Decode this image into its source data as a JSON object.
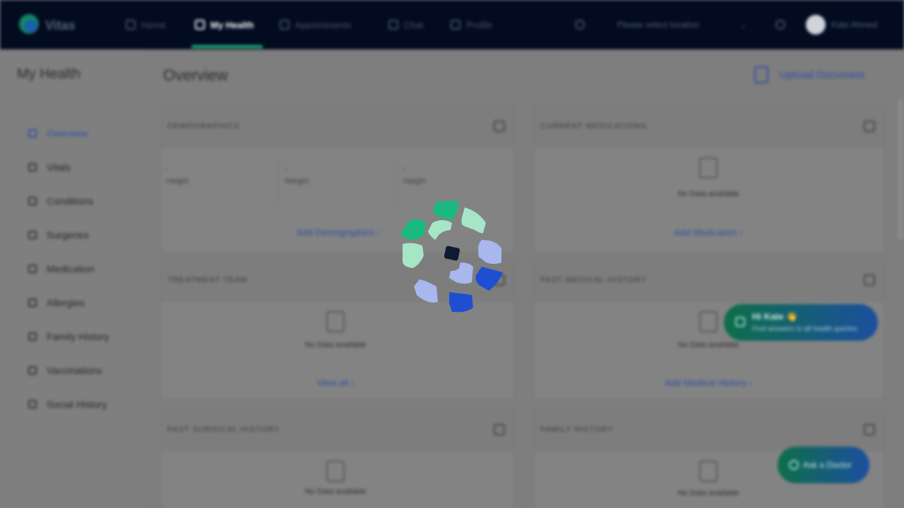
{
  "brand": {
    "name": "Vitas",
    "colors": {
      "green": "#1ab97f",
      "light_green": "#a6e6c7",
      "blue": "#1f4fd1",
      "light_blue": "#a8b8ee",
      "navy": "#020b1f"
    }
  },
  "topnav": {
    "items": [
      {
        "label": "Home",
        "icon": "home-icon"
      },
      {
        "label": "My Health",
        "icon": "heart-icon",
        "active": true
      },
      {
        "label": "Appointments",
        "icon": "calendar-icon"
      },
      {
        "label": "Chat",
        "icon": "chat-icon"
      },
      {
        "label": "Profile",
        "icon": "user-icon"
      }
    ],
    "profile_switch": "Please select location",
    "user_name": "Kate Ahmed"
  },
  "sidebar": {
    "title": "My Health",
    "items": [
      {
        "label": "Overview",
        "icon": "grid-icon",
        "active": true
      },
      {
        "label": "Vitals",
        "icon": "pulse-icon"
      },
      {
        "label": "Conditions",
        "icon": "clipboard-icon"
      },
      {
        "label": "Surgeries",
        "icon": "scalpel-icon"
      },
      {
        "label": "Medication",
        "icon": "pill-icon"
      },
      {
        "label": "Allergies",
        "icon": "alert-icon"
      },
      {
        "label": "Family History",
        "icon": "family-icon"
      },
      {
        "label": "Vaccinations",
        "icon": "syringe-icon"
      },
      {
        "label": "Social History",
        "icon": "social-icon"
      }
    ]
  },
  "main": {
    "title": "Overview",
    "upload_label": "Upload Document",
    "cards": {
      "demographics": {
        "title": "DEMOGRAPHICS",
        "columns": [
          {
            "value": "-",
            "label": "Height"
          },
          {
            "value": "-",
            "label": "Weight"
          },
          {
            "value": "-",
            "label": "Height"
          }
        ],
        "link": "Add Demographics"
      },
      "medications": {
        "title": "CURRENT MEDICATIONS",
        "empty": "No Data available",
        "link": "Add Medication"
      },
      "treatment_team": {
        "title": "TREATMENT TEAM",
        "empty": "No Data available",
        "link": "View all"
      },
      "past_medical": {
        "title": "PAST MEDICAL HISTORY",
        "empty": "No Data available",
        "link": "Add Medical History"
      },
      "past_surgical": {
        "title": "PAST SURGICAL HISTORY",
        "empty": "No Data available"
      },
      "family_history": {
        "title": "FAMILY HISTORY",
        "empty": "No Data available"
      }
    }
  },
  "fab": {
    "line1": "Hi Kate 👋",
    "line2": "Find answers to all health queries",
    "ask_label": "Ask a Doctor"
  },
  "loading": {
    "state": "loading",
    "icon": "loading-spinner-icon"
  }
}
